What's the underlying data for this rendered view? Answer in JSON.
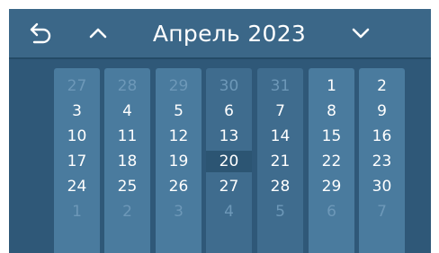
{
  "calendar": {
    "title": "Апрель 2023",
    "weeks": [
      [
        {
          "d": "27",
          "o": true
        },
        {
          "d": "28",
          "o": true
        },
        {
          "d": "29",
          "o": true
        },
        {
          "d": "30",
          "o": true
        },
        {
          "d": "31",
          "o": true
        },
        {
          "d": "1"
        },
        {
          "d": "2"
        }
      ],
      [
        {
          "d": "3"
        },
        {
          "d": "4"
        },
        {
          "d": "5"
        },
        {
          "d": "6"
        },
        {
          "d": "7"
        },
        {
          "d": "8"
        },
        {
          "d": "9"
        }
      ],
      [
        {
          "d": "10"
        },
        {
          "d": "11"
        },
        {
          "d": "12"
        },
        {
          "d": "13"
        },
        {
          "d": "14"
        },
        {
          "d": "15"
        },
        {
          "d": "16"
        }
      ],
      [
        {
          "d": "17"
        },
        {
          "d": "18"
        },
        {
          "d": "19"
        },
        {
          "d": "20",
          "sel": true
        },
        {
          "d": "21"
        },
        {
          "d": "22"
        },
        {
          "d": "23"
        }
      ],
      [
        {
          "d": "24"
        },
        {
          "d": "25"
        },
        {
          "d": "26"
        },
        {
          "d": "27"
        },
        {
          "d": "28"
        },
        {
          "d": "29"
        },
        {
          "d": "30"
        }
      ],
      [
        {
          "d": "1",
          "o": true
        },
        {
          "d": "2",
          "o": true
        },
        {
          "d": "3",
          "o": true
        },
        {
          "d": "4",
          "o": true
        },
        {
          "d": "5",
          "o": true
        },
        {
          "d": "6",
          "o": true
        },
        {
          "d": "7",
          "o": true
        }
      ]
    ]
  },
  "icons": {
    "back": "undo-arrow-icon",
    "prev": "chevron-up-icon",
    "next": "chevron-down-icon"
  },
  "colors": {
    "background": "#2f5878",
    "header": "#3b6788",
    "column": "#4a7b9e",
    "column_dim": "#3f6c8e",
    "selected_cell": "#2c5573",
    "other_month_text": "#6d98b8",
    "text": "#ffffff"
  }
}
